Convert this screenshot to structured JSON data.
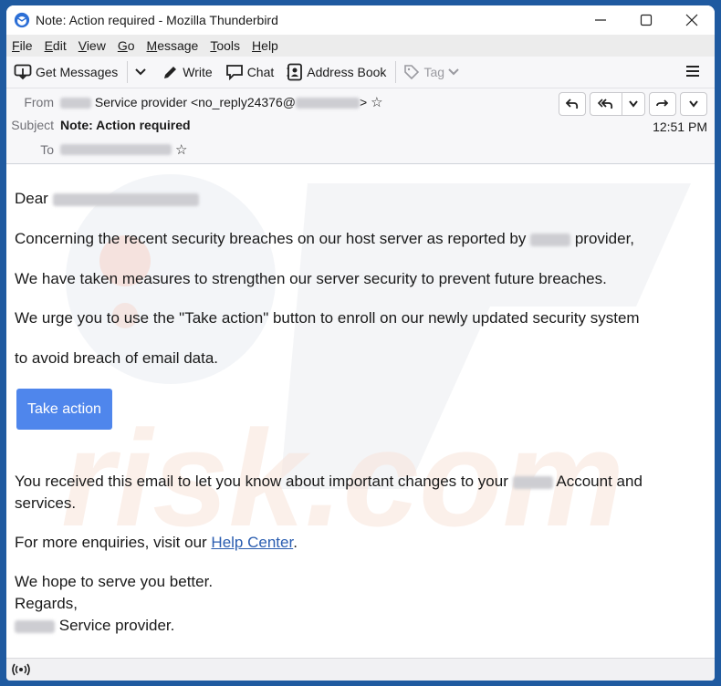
{
  "window": {
    "title": "Note: Action required - Mozilla Thunderbird",
    "controls": {
      "minimize": "–",
      "maximize": "☐",
      "close": "✕"
    }
  },
  "menubar": {
    "items": [
      {
        "label": "File",
        "accel": "F",
        "rest": "ile"
      },
      {
        "label": "Edit",
        "accel": "E",
        "rest": "dit"
      },
      {
        "label": "View",
        "accel": "V",
        "rest": "iew"
      },
      {
        "label": "Go",
        "accel": "G",
        "rest": "o"
      },
      {
        "label": "Message",
        "accel": "M",
        "rest": "essage"
      },
      {
        "label": "Tools",
        "accel": "T",
        "rest": "ools"
      },
      {
        "label": "Help",
        "accel": "H",
        "rest": "elp"
      }
    ]
  },
  "toolbar": {
    "get_messages": "Get Messages",
    "write": "Write",
    "chat": "Chat",
    "address_book": "Address Book",
    "tag": "Tag"
  },
  "header": {
    "from_label": "From",
    "from_name_suffix": "Service provider",
    "from_email": "<no_reply24376@",
    "from_email_end": ">",
    "subject_label": "Subject",
    "subject": "Note: Action required",
    "to_label": "To",
    "time": "12:51 PM"
  },
  "body": {
    "greeting": "Dear",
    "p1_start": "Concerning the recent security breaches on our host server as reported by",
    "p1_end": "provider,",
    "p2": "We have taken measures to strengthen our server security to prevent future breaches.",
    "p3": "We urge you to use the \"Take action\" button to enroll on our newly updated security system",
    "p4": "to avoid breach of email data.",
    "button": "Take action",
    "p5_start": "You received this email to let you know about important changes to your",
    "p5_end": "Account and services.",
    "p6_start": "For more enquiries, visit our",
    "p6_link": "Help Center",
    "p6_end": ".",
    "closing1": "We hope to serve you better.",
    "closing2": "Regards,",
    "signature_suffix": "Service provider."
  },
  "colors": {
    "accent_button": "#4f86ec",
    "link": "#2a5db0",
    "window_frame": "#1f5aa0"
  }
}
